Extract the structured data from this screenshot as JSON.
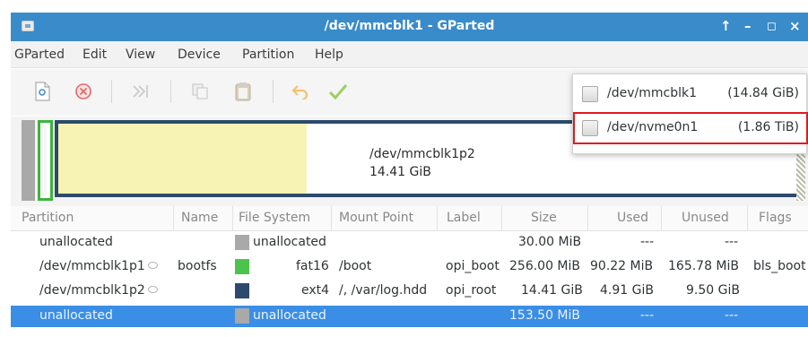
{
  "window": {
    "title": "/dev/mmcblk1 - GParted",
    "buttons": [
      "↑",
      "–",
      "◻",
      "×"
    ]
  },
  "menu": [
    "GParted",
    "Edit",
    "View",
    "Device",
    "Partition",
    "Help"
  ],
  "toolbar": {
    "icons": [
      "new-partition-icon",
      "delete-icon",
      "resize-move-icon",
      "copy-icon",
      "paste-icon",
      "undo-icon",
      "apply-icon"
    ]
  },
  "map": {
    "selected_label": "/dev/mmcblk1p2",
    "selected_size": "14.41 GiB"
  },
  "devices": [
    {
      "name": "/dev/mmcblk1",
      "size": "(14.84 GiB)"
    },
    {
      "name": "/dev/nvme0n1",
      "size": "(1.86 TiB)",
      "highlighted": true
    }
  ],
  "table": {
    "headers": [
      "Partition",
      "Name",
      "File System",
      "Mount Point",
      "Label",
      "Size",
      "Used",
      "Unused",
      "Flags"
    ],
    "rows": [
      {
        "partition": "unallocated",
        "name": "",
        "fs": "unallocated",
        "fs_color": "#a9a9a9",
        "mount": "",
        "label": "",
        "size": "30.00 MiB",
        "used": "---",
        "unused": "---",
        "flags": ""
      },
      {
        "partition": "/dev/mmcblk1p1",
        "name": "bootfs",
        "fs": "fat16",
        "fs_color": "#4cc34c",
        "mount": "/boot",
        "label": "opi_boot",
        "size": "256.00 MiB",
        "used": "90.22 MiB",
        "unused": "165.78 MiB",
        "flags": "bls_boot"
      },
      {
        "partition": "/dev/mmcblk1p2",
        "name": "",
        "fs": "ext4",
        "fs_color": "#2c4a6b",
        "mount": "/, /var/log.hdd",
        "label": "opi_root",
        "size": "14.41 GiB",
        "used": "4.91 GiB",
        "unused": "9.50 GiB",
        "flags": ""
      },
      {
        "partition": "unallocated",
        "name": "",
        "fs": "unallocated",
        "fs_color": "#a9a9a9",
        "mount": "",
        "label": "",
        "size": "153.50 MiB",
        "used": "---",
        "unused": "---",
        "flags": "",
        "selected": true
      }
    ]
  },
  "colors": {
    "titlebar": "#3a8bc9",
    "selection": "#3a8ee6",
    "highlight_border": "#e0191e"
  }
}
